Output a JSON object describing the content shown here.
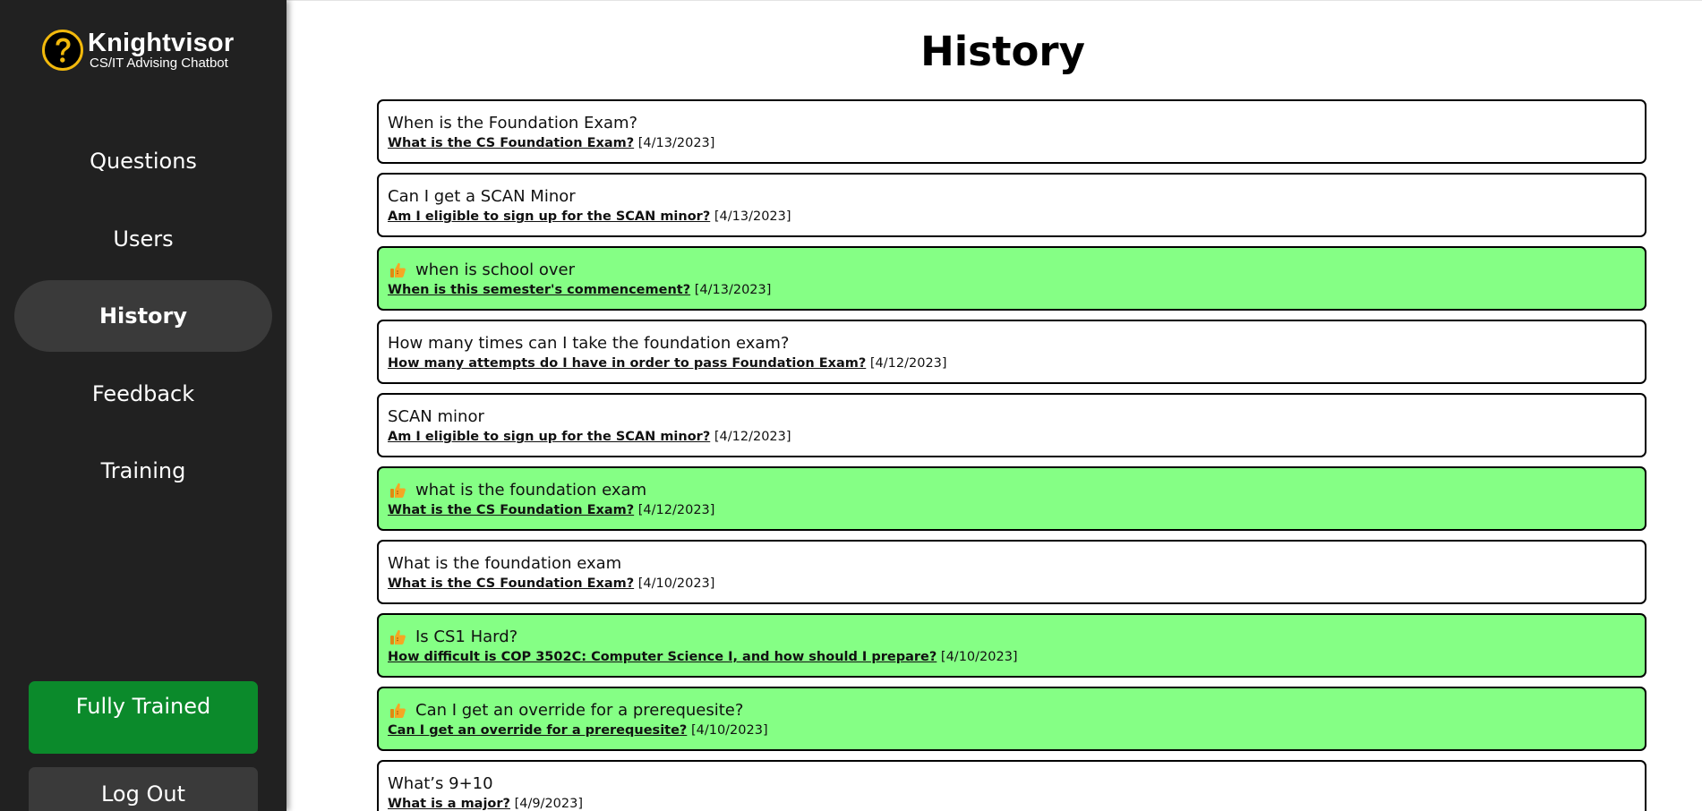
{
  "brand": {
    "name": "Knightvisor",
    "subtitle": "CS/IT Advising Chatbot",
    "logo_icon": "question-mark-circle-icon",
    "logo_color": "#f2b90c"
  },
  "nav": {
    "items": [
      {
        "label": "Questions",
        "active": false
      },
      {
        "label": "Users",
        "active": false
      },
      {
        "label": "History",
        "active": true
      },
      {
        "label": "Feedback",
        "active": false
      },
      {
        "label": "Training",
        "active": false
      }
    ]
  },
  "sidebar_buttons": {
    "trained_label": "Fully Trained",
    "logout_label": "Log Out"
  },
  "page": {
    "title": "History"
  },
  "colors": {
    "sidebar_bg": "#212121",
    "active_nav_bg": "#3a3a3a",
    "trained_button": "#0b8a2b",
    "liked_row": "#85ff85",
    "thumb_icon": "#f5a623"
  },
  "history": [
    {
      "question": "When is the Foundation Exam?",
      "answer": "What is the CS Foundation Exam?",
      "date": "[4/13/2023]",
      "liked": false
    },
    {
      "question": "Can I get a SCAN Minor",
      "answer": "Am I eligible to sign up for the SCAN minor?",
      "date": "[4/13/2023]",
      "liked": false
    },
    {
      "question": "when is school over",
      "answer": "When is this semester's commencement?",
      "date": "[4/13/2023]",
      "liked": true
    },
    {
      "question": "How many times can I take the foundation exam?",
      "answer": "How many attempts do I have in order to pass Foundation Exam?",
      "date": "[4/12/2023]",
      "liked": false
    },
    {
      "question": "SCAN minor",
      "answer": "Am I eligible to sign up for the SCAN minor?",
      "date": "[4/12/2023]",
      "liked": false
    },
    {
      "question": "what is the foundation exam",
      "answer": "What is the CS Foundation Exam?",
      "date": "[4/12/2023]",
      "liked": true
    },
    {
      "question": "What is the foundation exam",
      "answer": "What is the CS Foundation Exam?",
      "date": "[4/10/2023]",
      "liked": false
    },
    {
      "question": "Is CS1 Hard?",
      "answer": "How difficult is COP 3502C: Computer Science I, and how should I prepare?",
      "date": "[4/10/2023]",
      "liked": true
    },
    {
      "question": "Can I get an override for a prerequesite?",
      "answer": "Can I get an override for a prerequesite?",
      "date": "[4/10/2023]",
      "liked": true
    },
    {
      "question": "What’s 9+10",
      "answer": "What is a major?",
      "date": "[4/9/2023]",
      "liked": false
    }
  ]
}
